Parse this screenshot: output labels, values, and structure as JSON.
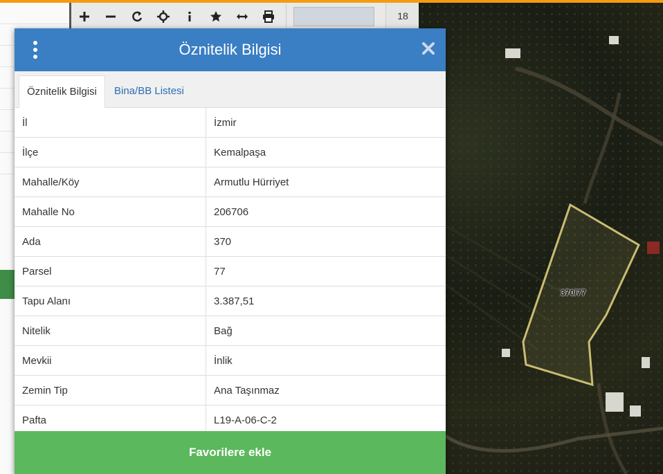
{
  "toolbar": {
    "tools": [
      {
        "name": "zoom-in",
        "glyph": "+"
      },
      {
        "name": "zoom-out",
        "glyph": "−"
      },
      {
        "name": "refresh",
        "glyph": "⟳"
      },
      {
        "name": "locate",
        "glyph": "⌖"
      },
      {
        "name": "info",
        "glyph": "i"
      },
      {
        "name": "favorite",
        "glyph": "★"
      },
      {
        "name": "measure",
        "glyph": "⟷"
      },
      {
        "name": "print",
        "glyph": "⎙"
      }
    ],
    "zoom_level": "18"
  },
  "map": {
    "parcel_label": "370/77"
  },
  "dialog": {
    "title": "Öznitelik Bilgisi",
    "tabs": [
      {
        "label": "Öznitelik Bilgisi",
        "active": true
      },
      {
        "label": "Bina/BB Listesi",
        "active": false
      }
    ],
    "rows": [
      {
        "key": "İl",
        "value": "İzmir"
      },
      {
        "key": "İlçe",
        "value": "Kemalpaşa"
      },
      {
        "key": "Mahalle/Köy",
        "value": "Armutlu Hürriyet"
      },
      {
        "key": "Mahalle No",
        "value": "206706"
      },
      {
        "key": "Ada",
        "value": "370"
      },
      {
        "key": "Parsel",
        "value": "77"
      },
      {
        "key": "Tapu Alanı",
        "value": "3.387,51"
      },
      {
        "key": "Nitelik",
        "value": "Bağ"
      },
      {
        "key": "Mevkii",
        "value": "İnlik"
      },
      {
        "key": "Zemin Tip",
        "value": "Ana Taşınmaz"
      },
      {
        "key": "Pafta",
        "value": "L19-A-06-C-2"
      }
    ],
    "favorite_button": "Favorilere ekle"
  },
  "colors": {
    "header": "#3a7ec3",
    "accent_bar": "#f39c12",
    "favorite_button": "#5cb85c",
    "parcel_outline": "#c9bd72"
  }
}
